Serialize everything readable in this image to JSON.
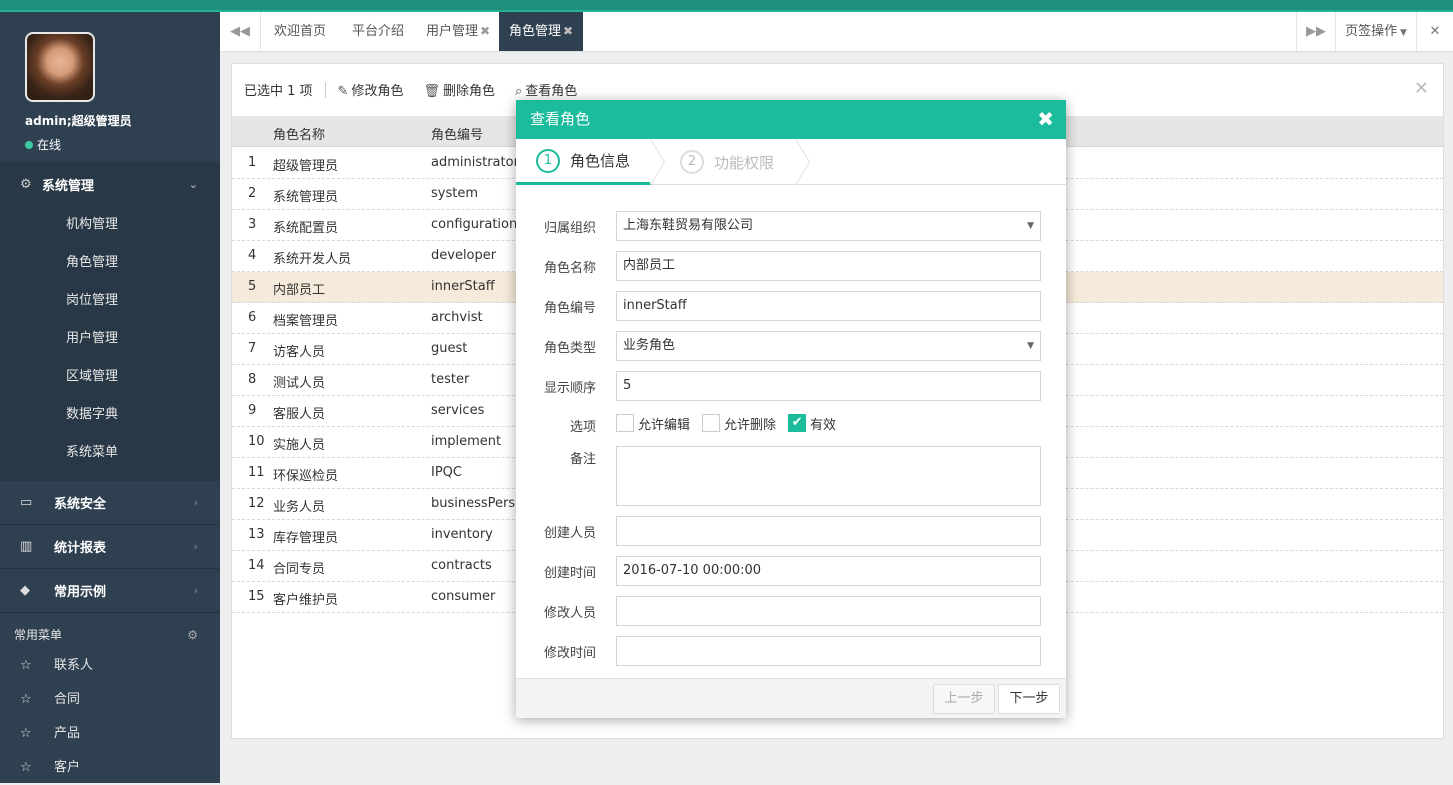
{
  "user": {
    "name": "admin;超级管理员",
    "status": "在线"
  },
  "sidebar": {
    "main_group": {
      "label": "系统管理",
      "items": [
        "机构管理",
        "角色管理",
        "岗位管理",
        "用户管理",
        "区域管理",
        "数据字典",
        "系统菜单"
      ]
    },
    "groups": [
      {
        "label": "系统安全"
      },
      {
        "label": "统计报表"
      },
      {
        "label": "常用示例"
      }
    ],
    "common_title": "常用菜单",
    "favorites": [
      "联系人",
      "合同",
      "产品",
      "客户"
    ]
  },
  "tabs": {
    "items": [
      {
        "label": "欢迎首页",
        "closable": false,
        "active": false
      },
      {
        "label": "平台介绍",
        "closable": false,
        "active": false
      },
      {
        "label": "用户管理",
        "closable": true,
        "active": false
      },
      {
        "label": "角色管理",
        "closable": true,
        "active": true
      }
    ],
    "page_ops": "页签操作"
  },
  "toolbar": {
    "selected_text": "已选中 1 项",
    "edit": "修改角色",
    "delete": "删除角色",
    "view": "查看角色"
  },
  "table": {
    "headers": [
      "角色名称",
      "角色编号"
    ],
    "rows": [
      {
        "no": "1",
        "name": "超级管理员",
        "code": "administrators"
      },
      {
        "no": "2",
        "name": "系统管理员",
        "code": "system"
      },
      {
        "no": "3",
        "name": "系统配置员",
        "code": "configuration"
      },
      {
        "no": "4",
        "name": "系统开发人员",
        "code": "developer"
      },
      {
        "no": "5",
        "name": "内部员工",
        "code": "innerStaff"
      },
      {
        "no": "6",
        "name": "档案管理员",
        "code": "archvist"
      },
      {
        "no": "7",
        "name": "访客人员",
        "code": "guest"
      },
      {
        "no": "8",
        "name": "测试人员",
        "code": "tester"
      },
      {
        "no": "9",
        "name": "客服人员",
        "code": "services"
      },
      {
        "no": "10",
        "name": "实施人员",
        "code": "implement"
      },
      {
        "no": "11",
        "name": "环保巡检员",
        "code": "IPQC"
      },
      {
        "no": "12",
        "name": "业务人员",
        "code": "businessPerso"
      },
      {
        "no": "13",
        "name": "库存管理员",
        "code": "inventory"
      },
      {
        "no": "14",
        "name": "合同专员",
        "code": "contracts"
      },
      {
        "no": "15",
        "name": "客户维护员",
        "code": "consumer"
      }
    ],
    "selected_no": "5"
  },
  "dialog": {
    "title": "查看角色",
    "steps": [
      {
        "num": "1",
        "label": "角色信息"
      },
      {
        "num": "2",
        "label": "功能权限"
      }
    ],
    "fields": {
      "org": {
        "label": "归属组织",
        "value": "上海东鞋贸易有限公司"
      },
      "name": {
        "label": "角色名称",
        "value": "内部员工"
      },
      "code": {
        "label": "角色编号",
        "value": "innerStaff"
      },
      "type": {
        "label": "角色类型",
        "value": "业务角色"
      },
      "order": {
        "label": "显示顺序",
        "value": "5"
      },
      "options": {
        "label": "选项",
        "allow_edit": "允许编辑",
        "allow_delete": "允许删除",
        "valid": "有效",
        "allow_edit_checked": false,
        "allow_delete_checked": false,
        "valid_checked": true
      },
      "remark": {
        "label": "备注",
        "value": ""
      },
      "creator": {
        "label": "创建人员",
        "value": ""
      },
      "created": {
        "label": "创建时间",
        "value": "2016-07-10 00:00:00"
      },
      "modifier": {
        "label": "修改人员",
        "value": ""
      },
      "modified": {
        "label": "修改时间",
        "value": ""
      }
    },
    "prev": "上一步",
    "next": "下一步"
  },
  "colors": {
    "accent": "#1abc9c",
    "sidebar": "#2f4050",
    "selected_row": "#f6ebda"
  }
}
